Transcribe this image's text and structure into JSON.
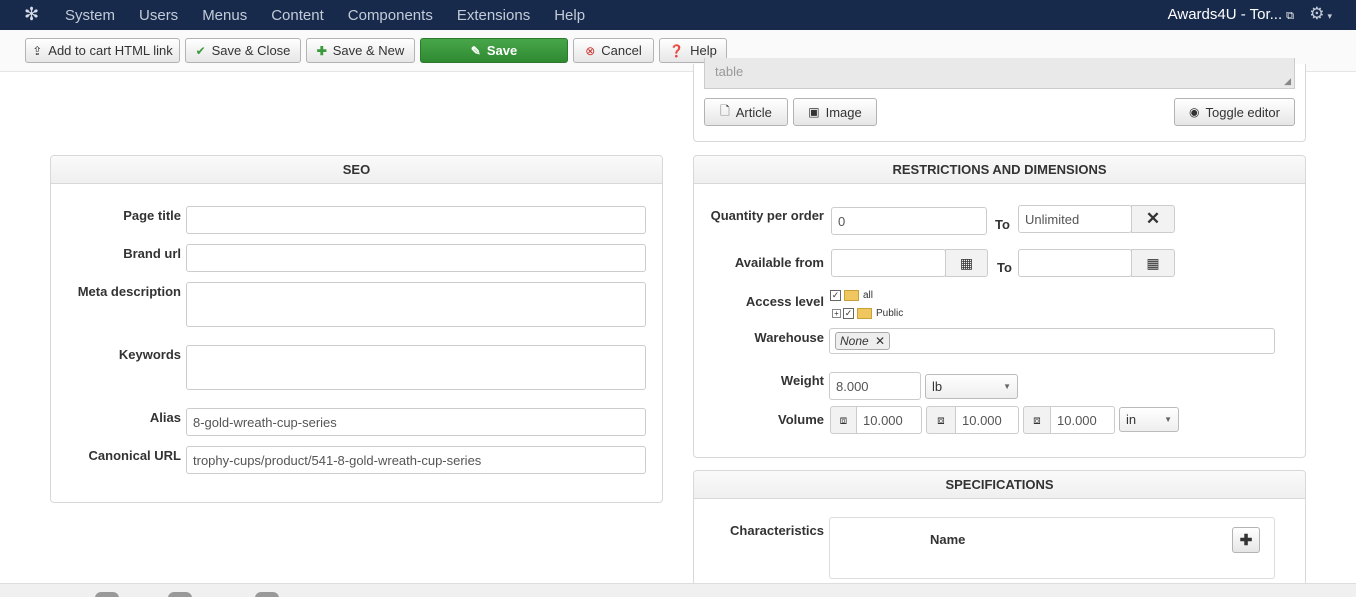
{
  "navbar": {
    "logo_icon": "joomla-icon",
    "menu": [
      "System",
      "Users",
      "Menus",
      "Content",
      "Components",
      "Extensions",
      "Help"
    ],
    "site_name": "Awards4U - Tor...",
    "gear_icon": "gear-icon"
  },
  "toolbar": {
    "add_to_cart": "Add to cart HTML link",
    "save_close": "Save & Close",
    "save_new": "Save & New",
    "save": "Save",
    "cancel": "Cancel",
    "help": "Help"
  },
  "editor": {
    "tail_text": "table",
    "article": "Article",
    "image": "Image",
    "toggle_editor": "Toggle editor"
  },
  "seo": {
    "title": "SEO",
    "page_title_label": "Page title",
    "page_title_value": "",
    "brand_url_label": "Brand url",
    "brand_url_value": "",
    "meta_description_label": "Meta description",
    "meta_description_value": "",
    "keywords_label": "Keywords",
    "keywords_value": "",
    "alias_label": "Alias",
    "alias_value": "8-gold-wreath-cup-series",
    "canonical_label": "Canonical URL",
    "canonical_value": "trophy-cups/product/541-8-gold-wreath-cup-series"
  },
  "restrictions": {
    "title": "RESTRICTIONS AND DIMENSIONS",
    "quantity_label": "Quantity per order",
    "quantity_from": "0",
    "to_label": "To",
    "quantity_to": "Unlimited",
    "available_label": "Available from",
    "available_from": "",
    "available_to": "",
    "access_label": "Access level",
    "access_items": [
      "all",
      "Public"
    ],
    "warehouse_label": "Warehouse",
    "warehouse_tag": "None",
    "weight_label": "Weight",
    "weight_value": "8.000",
    "weight_unit": "lb",
    "volume_label": "Volume",
    "volume_values": [
      "10.000",
      "10.000",
      "10.000"
    ],
    "volume_unit": "in"
  },
  "specifications": {
    "title": "SPECIFICATIONS",
    "characteristics_label": "Characteristics",
    "name_header": "Name"
  },
  "colors": {
    "navbar": "#172a4b",
    "save_button": "#3a9a3c"
  }
}
